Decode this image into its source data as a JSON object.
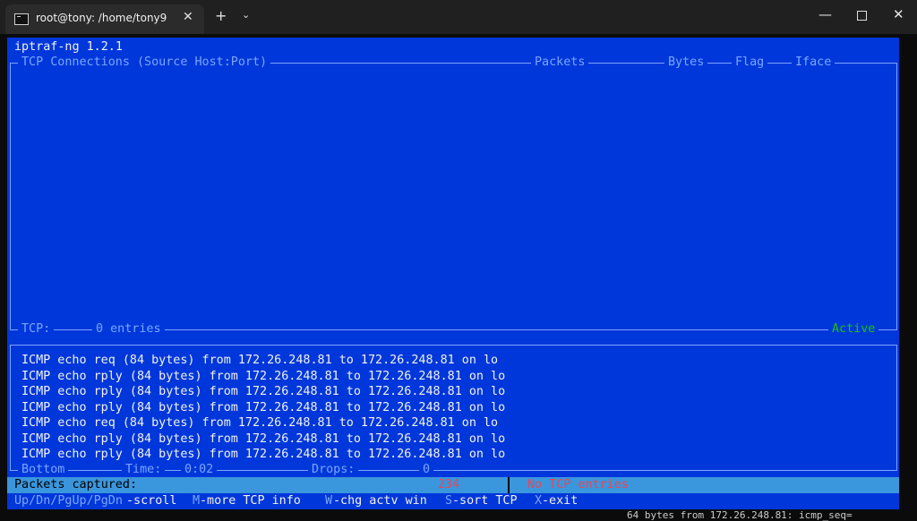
{
  "window": {
    "tab_title": "root@tony: /home/tony9",
    "tab_close": "✕",
    "new_tab": "+",
    "dropdown": "⌄",
    "minimize": "—",
    "close": "✕"
  },
  "terminal": {
    "app_title": "iptraf-ng 1.2.1",
    "header": {
      "connections": "TCP Connections (Source Host:Port)",
      "packets": "Packets",
      "bytes": "Bytes",
      "flag": "Flag",
      "iface": "Iface"
    },
    "tcp_status": {
      "label": "TCP:",
      "entries": "0 entries",
      "state": "Active"
    },
    "log_lines": [
      "ICMP echo req (84 bytes) from 172.26.248.81 to 172.26.248.81 on lo",
      "ICMP echo rply (84 bytes) from 172.26.248.81 to 172.26.248.81 on lo",
      "ICMP echo rply (84 bytes) from 172.26.248.81 to 172.26.248.81 on lo",
      "ICMP echo rply (84 bytes) from 172.26.248.81 to 172.26.248.81 on lo",
      "ICMP echo req (84 bytes) from 172.26.248.81 to 172.26.248.81 on lo",
      "ICMP echo rply (84 bytes) from 172.26.248.81 to 172.26.248.81 on lo",
      "ICMP echo rply (84 bytes) from 172.26.248.81 to 172.26.248.81 on lo"
    ],
    "bottom_status": {
      "bottom": "Bottom",
      "time_label": "Time:",
      "time_value": "0:02",
      "drops_label": "Drops:",
      "drops_value": "0"
    },
    "packets_captured": {
      "label": "Packets captured:",
      "value": "234",
      "message": "No TCP entries"
    },
    "help": [
      {
        "key": "Up/Dn/PgUp/PgDn",
        "action": "-scroll"
      },
      {
        "key": "M",
        "action": "-more TCP info"
      },
      {
        "key": "W",
        "action": "-chg actv win"
      },
      {
        "key": "S",
        "action": "-sort TCP"
      },
      {
        "key": "X",
        "action": "-exit"
      }
    ]
  },
  "background_text": "64 bytes from 172.26.248.81: icmp_seq="
}
